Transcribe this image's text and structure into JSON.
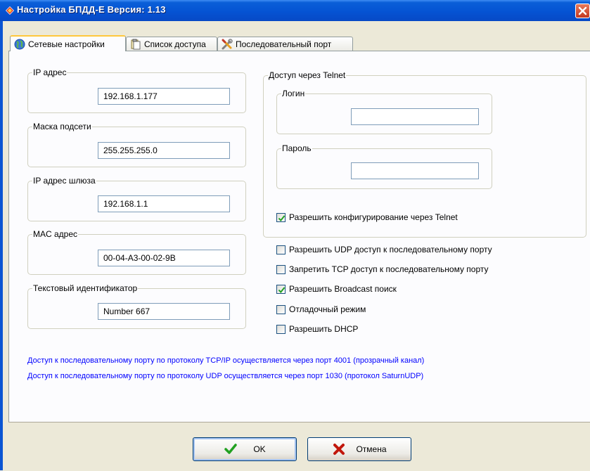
{
  "window": {
    "title": "Настройка БПДД-Е  Версия: 1.13",
    "close_label": "✕"
  },
  "tabs": [
    {
      "label": "Сетевые настройки",
      "icon": "network-globe-icon",
      "active": true
    },
    {
      "label": "Список доступа",
      "icon": "clipboard-icon",
      "active": false
    },
    {
      "label": "Последовательный порт",
      "icon": "tools-icon",
      "active": false
    }
  ],
  "network": {
    "ip": {
      "label": "IP адрес",
      "value": "192.168.1.177"
    },
    "mask": {
      "label": "Маска подсети",
      "value": "255.255.255.0"
    },
    "gateway": {
      "label": "IP адрес шлюза",
      "value": "192.168.1.1"
    },
    "mac": {
      "label": "MAC адрес",
      "value": "00-04-A3-00-02-9B"
    },
    "text_id": {
      "label": "Текстовый идентификатор",
      "value": "Number 667"
    }
  },
  "telnet": {
    "group_label": "Доступ через Telnet",
    "login_label": "Логин",
    "login_value": "",
    "password_label": "Пароль",
    "password_value": "",
    "allow_config": {
      "label": "Разрешить конфигурирование через Telnet",
      "checked": true
    }
  },
  "options": [
    {
      "label": "Разрешить UDP доступ к последовательному порту",
      "checked": false
    },
    {
      "label": "Запретить TCP доступ к последовательному порту",
      "checked": false
    },
    {
      "label": "Разрешить Broadcast поиск",
      "checked": true
    },
    {
      "label": "Отладочный режим",
      "checked": false
    },
    {
      "label": "Разрешить DHCP",
      "checked": false
    }
  ],
  "info": {
    "tcp_note": "Доступ к последовательному порту по протоколу TCP/IP осуществляется через порт 4001 (прозрачный канал)",
    "udp_note": "Доступ к последовательному порту по протоколу UDP осуществляется через порт 1030 (протокол SaturnUDP)"
  },
  "buttons": {
    "ok_label": "OK",
    "cancel_label": "Отмена"
  },
  "colors": {
    "titlebar": "#0553d3",
    "info_text": "#0000ff",
    "check_mark": "#21a121",
    "cancel_x": "#c1170c"
  }
}
